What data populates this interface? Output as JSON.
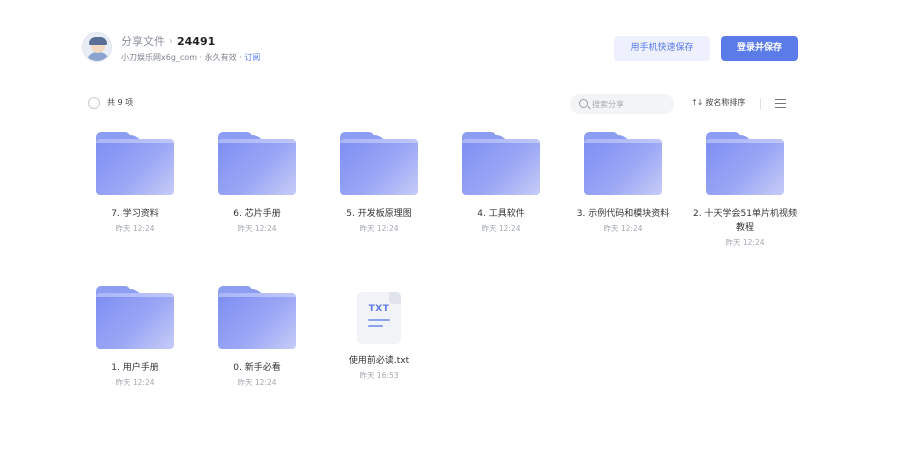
{
  "header": {
    "breadcrumb_parent": "分享文件",
    "breadcrumb_sep": "›",
    "title": "24491",
    "owner": "小刀娱乐网x6g_com",
    "validity": "· 永久有效 ·",
    "subscribe": "订阅",
    "phone_save_label": "用手机快速保存",
    "login_save_label": "登录并保存"
  },
  "toolbar": {
    "count_label": "共 9 项",
    "search_placeholder": "搜索分享",
    "sort_icon": "↑↓",
    "sort_label": "按名称排序"
  },
  "items": [
    {
      "type": "folder",
      "name": "7. 学习资料",
      "date": "昨天 12:24"
    },
    {
      "type": "folder",
      "name": "6. 芯片手册",
      "date": "昨天 12:24"
    },
    {
      "type": "folder",
      "name": "5. 开发板原理图",
      "date": "昨天 12:24"
    },
    {
      "type": "folder",
      "name": "4. 工具软件",
      "date": "昨天 12:24"
    },
    {
      "type": "folder",
      "name": "3. 示例代码和模块资料",
      "date": "昨天 12:24"
    },
    {
      "type": "folder",
      "name": "2. 十天学会51单片机视频教程",
      "date": "昨天 12:24"
    },
    {
      "type": "folder",
      "name": "1. 用户手册",
      "date": "昨天 12:24"
    },
    {
      "type": "folder",
      "name": "0. 新手必看",
      "date": "昨天 12:24"
    },
    {
      "type": "txt",
      "name": "使用前必读.txt",
      "date": "昨天 16:53",
      "icon_label": "TXT"
    }
  ],
  "colors": {
    "accent": "#5b7be9",
    "folder": "#8c9df2"
  }
}
